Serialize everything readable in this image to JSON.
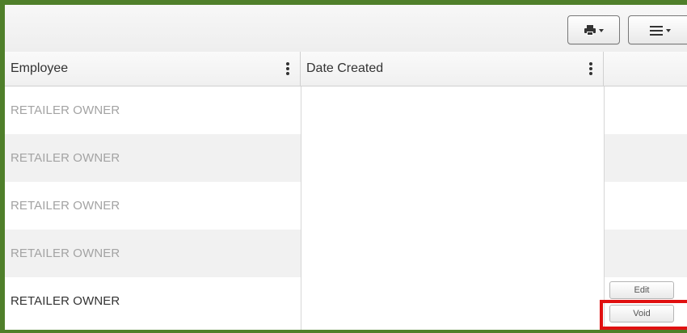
{
  "toolbar": {
    "print_icon": "printer-icon",
    "menu_icon": "hamburger-icon"
  },
  "columns": [
    {
      "label": "Employee"
    },
    {
      "label": "Date Created"
    },
    {
      "label": ""
    }
  ],
  "rows": [
    {
      "employee": "RETAILER OWNER",
      "date_created": ""
    },
    {
      "employee": "RETAILER OWNER",
      "date_created": ""
    },
    {
      "employee": "RETAILER OWNER",
      "date_created": ""
    },
    {
      "employee": "RETAILER OWNER",
      "date_created": ""
    },
    {
      "employee": "RETAILER OWNER",
      "date_created": ""
    }
  ],
  "actions": {
    "edit_label": "Edit",
    "void_label": "Void"
  },
  "colors": {
    "frame_border": "#4f7f2a",
    "highlight": "#e01010",
    "muted_text": "#a3a3a3",
    "active_text": "#333333"
  }
}
